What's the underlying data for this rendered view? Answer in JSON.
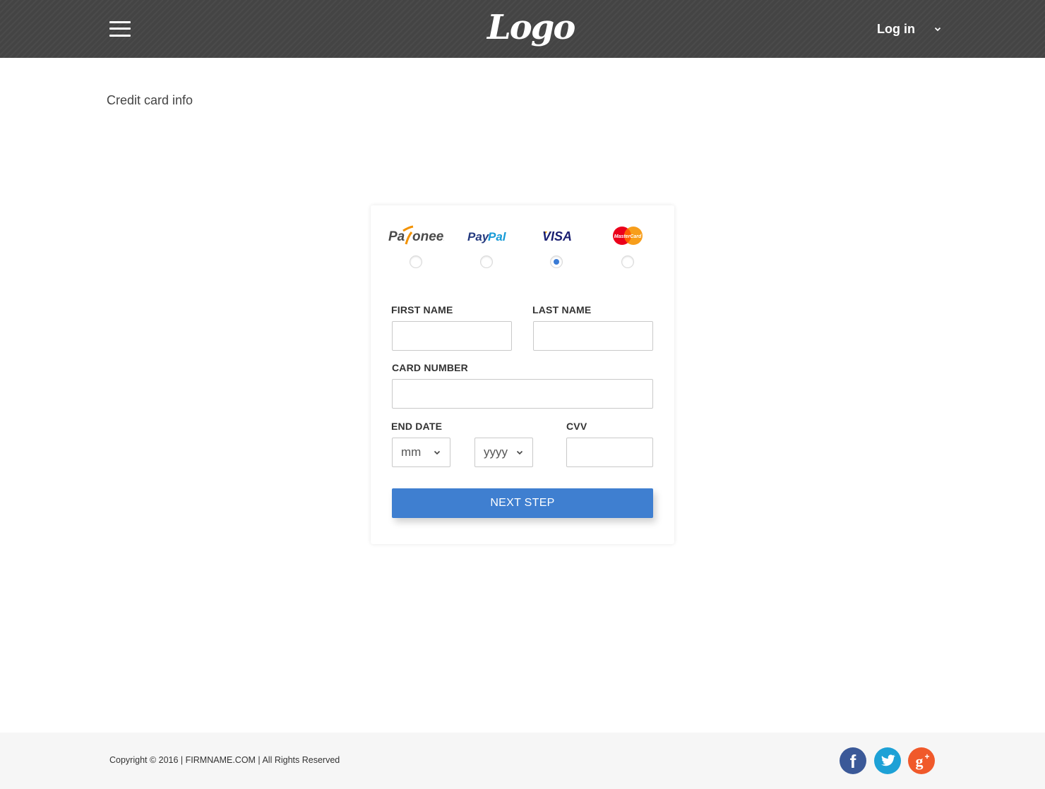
{
  "header": {
    "logo_text": "Logo",
    "login_label": "Log in"
  },
  "page": {
    "title": "Credit card info"
  },
  "payment": {
    "providers": [
      {
        "name": "Payoneer",
        "selected": false
      },
      {
        "name": "PayPal",
        "selected": false
      },
      {
        "name": "VISA",
        "selected": true
      },
      {
        "name": "MasterCard",
        "selected": false
      }
    ],
    "accent_color": "#3f7fd0"
  },
  "form": {
    "first_name_label": "FIRST NAME",
    "first_name_value": "",
    "last_name_label": "LAST NAME",
    "last_name_value": "",
    "card_number_label": "CARD NUMBER",
    "card_number_value": "",
    "end_date_label": "END DATE",
    "month_value": "mm",
    "year_value": "yyyy",
    "cvv_label": "CVV",
    "cvv_value": "",
    "next_button_label": "NEXT STEP"
  },
  "footer": {
    "copyright": "Copyright © 2016 | FIRMNAME.COM | All Rights Reserved",
    "social": [
      "facebook",
      "twitter",
      "google-plus"
    ]
  }
}
